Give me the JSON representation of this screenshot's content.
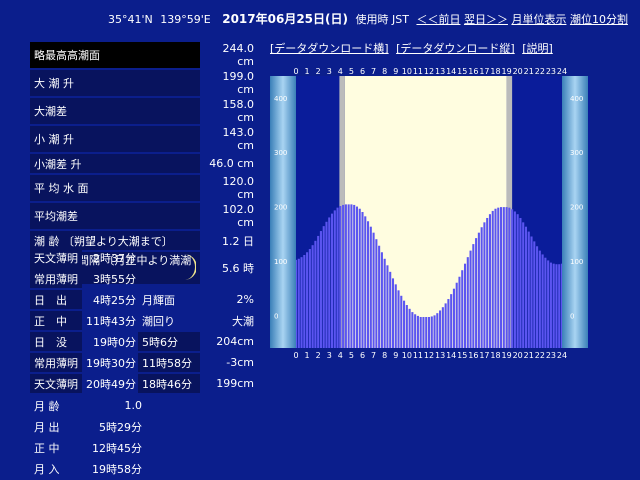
{
  "header": {
    "lat": "35°41'N",
    "lon": "139°59'E",
    "date": "2017年06月25日(日)",
    "tz": "使用時 JST",
    "prev": "＜＜前日",
    "next": "翌日＞＞",
    "monthly": "月単位表示",
    "interval": "潮位10分割"
  },
  "tide_info": [
    {
      "label": "略最高高潮面",
      "value": "244.0 cm"
    },
    {
      "label": "大 潮 升",
      "value": "199.0 cm"
    },
    {
      "label": "大潮差",
      "value": "158.0 cm"
    },
    {
      "label": "小 潮 升",
      "value": "143.0 cm"
    },
    {
      "label": "小潮差 升",
      "value": "46.0 cm"
    },
    {
      "label": "平 均 水 面",
      "value": "120.0 cm"
    },
    {
      "label": "平均潮差",
      "value": "102.0 cm"
    },
    {
      "label": "潮 齢 〔朔望より大潮まで〕",
      "value": "1.2 日"
    },
    {
      "label": "平均高潮間隔 〔月正中より満潮 〕",
      "value": "5.6 時"
    }
  ],
  "sun": [
    {
      "label": "天文薄明",
      "value": "2時37分"
    },
    {
      "label": "常用薄明",
      "value": "3時55分"
    },
    {
      "label": "日　出",
      "value": "4時25分"
    },
    {
      "label": "正　中",
      "value": "11時43分"
    },
    {
      "label": "日　没",
      "value": "19時0分"
    },
    {
      "label": "常用薄明",
      "value": "19時30分"
    },
    {
      "label": "天文薄明",
      "value": "20時49分"
    }
  ],
  "moon_phase": {
    "label": "月輝面",
    "value": "2%"
  },
  "tide_type": {
    "label": "潮回り",
    "value": "大潮"
  },
  "tide_events": [
    {
      "time": "5時6分",
      "level": "204cm"
    },
    {
      "time": "11時58分",
      "level": "-3cm"
    },
    {
      "time": "18時46分",
      "level": "199cm"
    }
  ],
  "moon": [
    {
      "label": "月 齢",
      "value": "1.0"
    },
    {
      "label": "月 出",
      "value": "5時29分"
    },
    {
      "label": "正 中",
      "value": "12時45分"
    },
    {
      "label": "月 入",
      "value": "19時58分"
    }
  ],
  "links": {
    "download_h": "[データダウンロード横]",
    "download_v": "[データダウンロード縦]",
    "help": "[説明]"
  },
  "chart_data": {
    "type": "bar",
    "hour_labels": [
      "0",
      "1",
      "2",
      "3",
      "4",
      "5",
      "6",
      "7",
      "8",
      "9",
      "10",
      "11",
      "12",
      "13",
      "14",
      "15",
      "16",
      "17",
      "18",
      "19",
      "20",
      "21",
      "22",
      "23",
      "24"
    ],
    "y_ticks": [
      "400",
      "300",
      "200",
      "100",
      "0"
    ],
    "ylim": [
      -60,
      440
    ],
    "xlim": [
      0,
      24
    ],
    "highs": [
      {
        "hour": 5.1,
        "cm": 204
      },
      {
        "hour": 18.77,
        "cm": 199
      }
    ],
    "low": {
      "hour": 11.97,
      "cm": -3
    },
    "x": [
      0,
      0.25,
      0.5,
      0.75,
      1,
      1.25,
      1.5,
      1.75,
      2,
      2.25,
      2.5,
      2.75,
      3,
      3.25,
      3.5,
      3.75,
      4,
      4.25,
      4.5,
      4.75,
      5,
      5.25,
      5.5,
      5.75,
      6,
      6.25,
      6.5,
      6.75,
      7,
      7.25,
      7.5,
      7.75,
      8,
      8.25,
      8.5,
      8.75,
      9,
      9.25,
      9.5,
      9.75,
      10,
      10.25,
      10.5,
      10.75,
      11,
      11.25,
      11.5,
      11.75,
      12,
      12.25,
      12.5,
      12.75,
      13,
      13.25,
      13.5,
      13.75,
      14,
      14.25,
      14.5,
      14.75,
      15,
      15.25,
      15.5,
      15.75,
      16,
      16.25,
      16.5,
      16.75,
      17,
      17.25,
      17.5,
      17.75,
      18,
      18.25,
      18.5,
      18.75,
      19,
      19.25,
      19.5,
      19.75,
      20,
      20.25,
      20.5,
      20.75,
      21,
      21.25,
      21.5,
      21.75,
      22,
      22.25,
      22.5,
      22.75,
      23,
      23.25,
      23.5,
      23.75,
      24
    ],
    "values": [
      102,
      104,
      107,
      111,
      116,
      122,
      129,
      137,
      146,
      155,
      164,
      172,
      180,
      187,
      193,
      198,
      201,
      203,
      204,
      204,
      204,
      203,
      200,
      196,
      190,
      182,
      173,
      163,
      152,
      140,
      128,
      116,
      104,
      92,
      80,
      68,
      57,
      46,
      36,
      27,
      19,
      12,
      6,
      2,
      -1,
      -3,
      -3,
      -3,
      -3,
      -2,
      0,
      4,
      9,
      15,
      22,
      30,
      39,
      49,
      60,
      71,
      83,
      95,
      107,
      119,
      131,
      142,
      152,
      162,
      171,
      179,
      186,
      192,
      196,
      198,
      199,
      199,
      199,
      198,
      195,
      191,
      186,
      179,
      171,
      163,
      154,
      145,
      136,
      127,
      119,
      112,
      106,
      101,
      97,
      95,
      94,
      94,
      95,
      96,
      98
    ]
  }
}
